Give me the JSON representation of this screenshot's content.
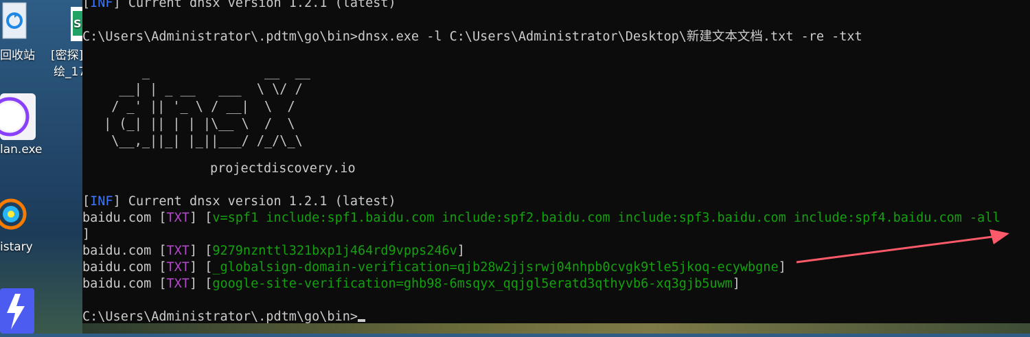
{
  "desktop": {
    "icons": [
      {
        "name": "recycle-bin-icon",
        "label": "回收站"
      },
      {
        "name": "encrypted-doc-icon",
        "label": "[密探]",
        "sublabel": "绘_17"
      },
      {
        "name": "lan-app-icon",
        "label": "lan.exe"
      },
      {
        "name": "history-app-icon",
        "label": "istary"
      }
    ]
  },
  "terminal": {
    "top_info": {
      "tag": "INF",
      "text": "Current dnsx version 1.2.1 (latest)"
    },
    "prompt1": {
      "path": "C:\\Users\\Administrator\\.pdtm\\go\\bin>",
      "command": "dnsx.exe -l C:\\Users\\Administrator\\Desktop\\新建文本文档.txt -re -txt"
    },
    "banner": "      _               __  __\n   __| | _ __   ___  \\ \\/ /\n  / _' || '_ \\ / __|  \\  /\n | (_| || | | |\\__ \\  /  \\\n  \\__,_||_| |_||___/ /_/\\_\\",
    "site": "projectdiscovery.io",
    "info": {
      "tag": "INF",
      "text": "Current dnsx version 1.2.1 (latest)"
    },
    "results": [
      {
        "host": "baidu.com",
        "type": "TXT",
        "value": "v=spf1 include:spf1.baidu.com include:spf2.baidu.com include:spf3.baidu.com include:spf4.baidu.com -all"
      },
      {
        "host": "baidu.com",
        "type": "TXT",
        "value": "9279nznttl321bxp1j464rd9vpps246v"
      },
      {
        "host": "baidu.com",
        "type": "TXT",
        "value": "_globalsign-domain-verification=qjb28w2jjsrwj04nhpb0cvgk9tle5jkoq-ecywbgne"
      },
      {
        "host": "baidu.com",
        "type": "TXT",
        "value": "google-site-verification=ghb98-6msqyx_qqjgl5eratd3qthyvb6-xq3gjb5uwm"
      }
    ],
    "prompt2": {
      "path": "C:\\Users\\Administrator\\.pdtm\\go\\bin>"
    }
  },
  "colors": {
    "annotation_arrow": "#ff5a6a"
  }
}
